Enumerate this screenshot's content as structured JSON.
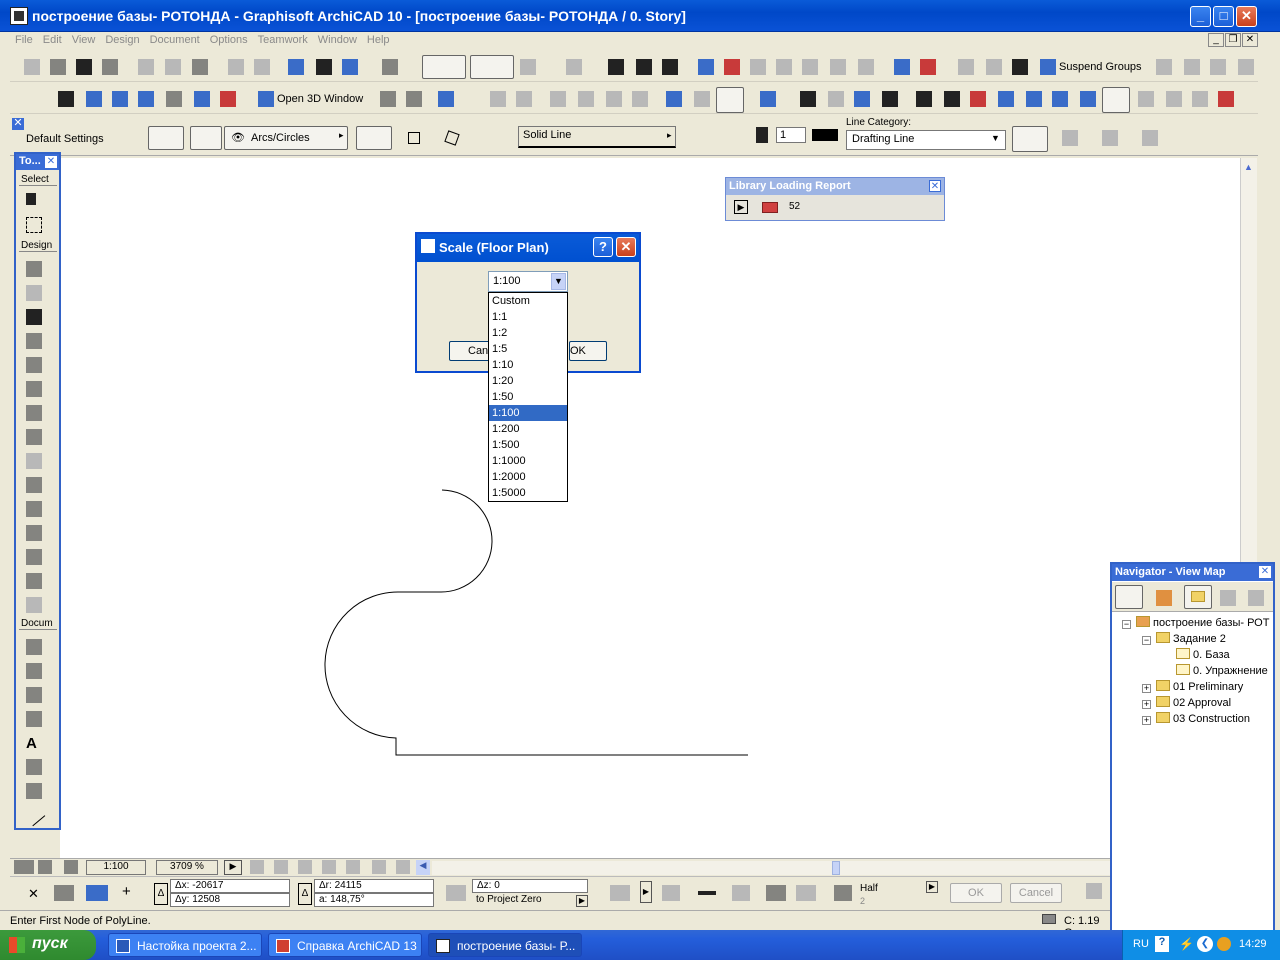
{
  "window": {
    "title": "построение базы- РОТОНДА - Graphisoft ArchiCAD 10 - [построение базы- РОТОНДА / 0. Story]"
  },
  "menu": [
    "File",
    "Edit",
    "View",
    "Design",
    "Document",
    "Options",
    "Teamwork",
    "Window",
    "Help"
  ],
  "toolbar": {
    "suspend_groups": "Suspend Groups",
    "open_3d": "Open 3D Window"
  },
  "infobox": {
    "default_settings": "Default Settings",
    "geometry_label": "Arcs/Circles",
    "line_type": "Solid Line",
    "pen_value": "1",
    "line_category_label": "Line Category:",
    "line_category_value": "Drafting Line"
  },
  "toolbox": {
    "title": "To...",
    "select": "Select",
    "design": "Design",
    "document": "Docum"
  },
  "library": {
    "title": "Library Loading Report",
    "count": "52"
  },
  "dialog": {
    "title": "Scale (Floor Plan)",
    "selected": "1:100",
    "cancel_partial": "Cance",
    "ok_partial": "OK",
    "options": [
      "Custom",
      "1:1",
      "1:2",
      "1:5",
      "1:10",
      "1:20",
      "1:50",
      "1:100",
      "1:200",
      "1:500",
      "1:1000",
      "1:2000",
      "1:5000"
    ],
    "selected_index": 7
  },
  "navigator": {
    "title": "Navigator - View Map",
    "root": "построение базы- РОТ",
    "items": [
      {
        "label": "Задание 2"
      },
      {
        "label": "0. База"
      },
      {
        "label": "0. Упражнение"
      },
      {
        "label": "01 Preliminary"
      },
      {
        "label": "02 Approval"
      },
      {
        "label": "03 Construction"
      }
    ]
  },
  "bottombar": {
    "scale": "1:100",
    "zoom": "3709 %"
  },
  "coords": {
    "dx": "Δx: -20617",
    "dy": "Δy: 12508",
    "dr": "Δr: 24115",
    "angle": "a: 148,75°",
    "dz": "Δz: 0",
    "dz_ref": "to Project Zero",
    "half": "Half",
    "half_sub": "2",
    "ok": "OK",
    "cancel": "Cancel"
  },
  "status": {
    "message": "Enter First Node of PolyLine.",
    "disk": "C: 1.19 G"
  },
  "taskbar": {
    "start": "пуск",
    "tasks": [
      "Настойка проекта 2...",
      "Справка ArchiCAD 13",
      "построение базы- Р..."
    ],
    "lang": "RU",
    "time": "14:29"
  }
}
